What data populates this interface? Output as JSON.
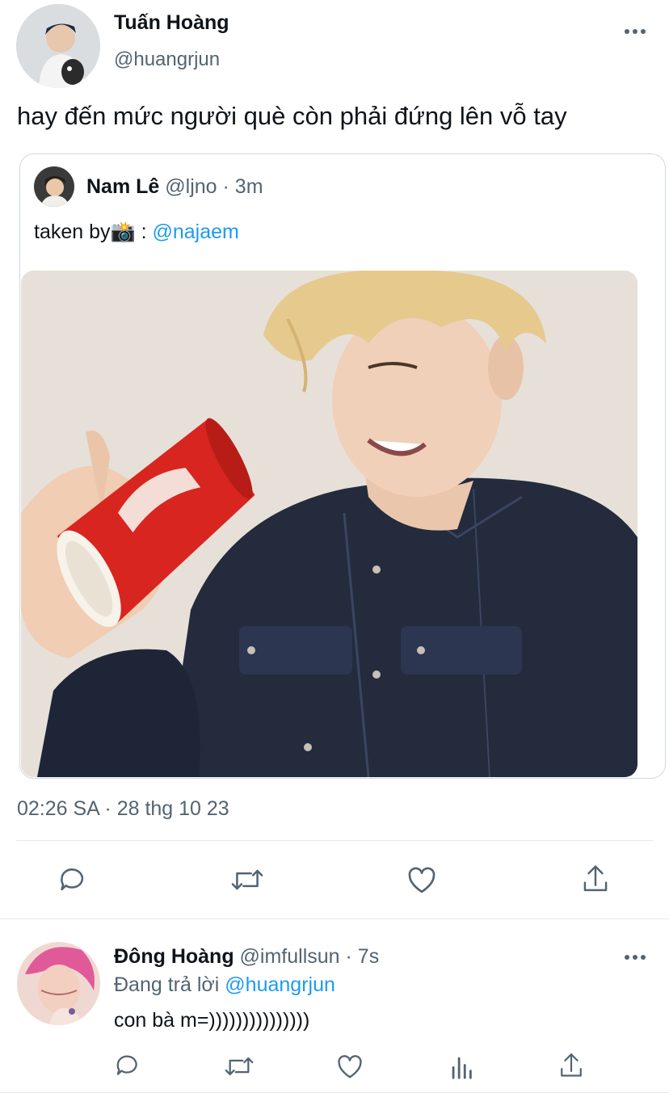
{
  "main_tweet": {
    "author_name": "Tuấn Hoàng",
    "author_handle": "@huangrjun",
    "text": "hay đến mức người què còn phải đứng lên vỗ tay",
    "more_icon": "more-horizontal-icon",
    "timestamp": "02:26 SA · 28 thg 10 23"
  },
  "quoted_tweet": {
    "author_name": "Nam Lê",
    "author_handle": "@ljno",
    "time": "3m",
    "text_prefix": "taken by📸 :",
    "mention": "@najaem",
    "media": "photo"
  },
  "action_bar": {
    "icons": [
      "reply-icon",
      "retweet-icon",
      "like-icon",
      "share-icon"
    ]
  },
  "reply": {
    "author_name": "Đông Hoàng",
    "author_handle": "@imfullsun",
    "time": "· 7s",
    "replying_label": "Đang trả lời",
    "replying_to": "@huangrjun",
    "text": "con bà m=)))))))))))))))",
    "more_icon": "more-horizontal-icon",
    "icons": [
      "reply-icon",
      "retweet-icon",
      "like-icon",
      "analytics-icon",
      "share-icon"
    ]
  },
  "colors": {
    "accent": "#1d9bf0",
    "text_primary": "#0f1419",
    "text_secondary": "#536471",
    "divider": "#e7e9ea",
    "cup_red": "#d8251f",
    "jacket": "#222a3c",
    "hair": "#e8cc8e"
  }
}
